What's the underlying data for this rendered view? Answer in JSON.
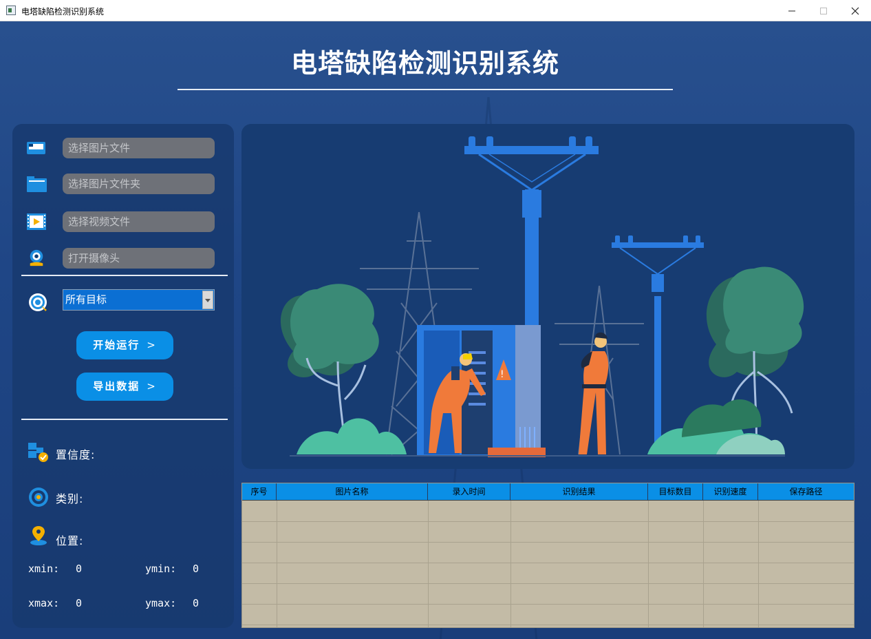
{
  "window": {
    "title": "电塔缺陷检测识别系统"
  },
  "header": {
    "title": "电塔缺陷检测识别系统"
  },
  "sources": [
    {
      "placeholder": "选择图片文件",
      "icon": "image-file-icon"
    },
    {
      "placeholder": "选择图片文件夹",
      "icon": "folder-icon"
    },
    {
      "placeholder": "选择视频文件",
      "icon": "video-file-icon"
    },
    {
      "placeholder": "打开摄像头",
      "icon": "camera-icon"
    }
  ],
  "target_select": {
    "value": "所有目标"
  },
  "buttons": {
    "start": "开始运行",
    "export": "导出数据",
    "chevron": ">"
  },
  "info": {
    "confidence_label": "置信度:",
    "class_label": "类别:",
    "position_label": "位置:",
    "xmin_label": "xmin:",
    "xmin": "0",
    "ymin_label": "ymin:",
    "ymin": "0",
    "xmax_label": "xmax:",
    "xmax": "0",
    "ymax_label": "ymax:",
    "ymax": "0"
  },
  "table": {
    "columns": [
      "序号",
      "图片名称",
      "录入时间",
      "识别结果",
      "目标数目",
      "识别速度",
      "保存路径"
    ]
  },
  "colors": {
    "accent": "#0a8fe6",
    "background": "#1f4686",
    "table_body": "#c3bba6"
  }
}
